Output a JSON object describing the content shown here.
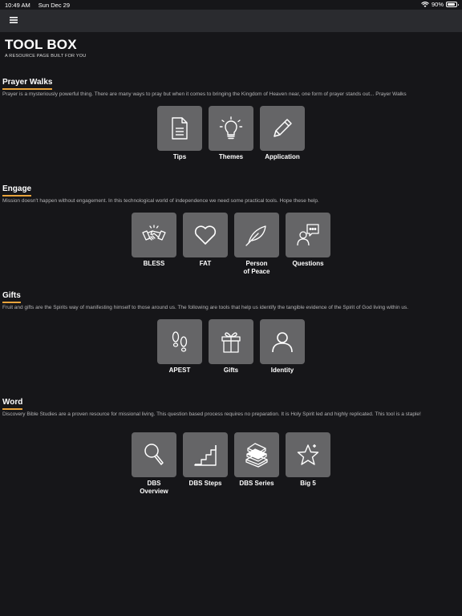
{
  "status": {
    "time": "10:49 AM",
    "date": "Sun Dec 29",
    "battery": "90%"
  },
  "header": {
    "title": "TOOL BOX",
    "subtitle": "A RESOURCE PAGE BUILT FOR YOU"
  },
  "sections": [
    {
      "title": "Prayer Walks",
      "description": "Prayer is a mysteriously powerful thing. There are many ways to pray but when it comes to bringing the Kingdom of Heaven near, one form of prayer stands out... Prayer Walks",
      "tiles": [
        {
          "label": "Tips",
          "icon": "document-icon"
        },
        {
          "label": "Themes",
          "icon": "lightbulb-icon"
        },
        {
          "label": "Application",
          "icon": "pencil-icon"
        }
      ]
    },
    {
      "title": "Engage",
      "description": "Mission doesn't happen without engagement. In this technological world of independence we need some practical tools. Hope these help.",
      "tiles": [
        {
          "label": "BLESS",
          "icon": "handshake-icon"
        },
        {
          "label": "FAT",
          "icon": "heart-icon"
        },
        {
          "label": "Person\nof Peace",
          "icon": "feather-icon"
        },
        {
          "label": "Questions",
          "icon": "person-speech-icon"
        }
      ]
    },
    {
      "title": "Gifts",
      "description": "Fruit and gifts are the Spirits way of manifesting himself to those around us. The following are tools that help us identify the tangible evidence of the Spirit of God living within us.",
      "tiles": [
        {
          "label": "APEST",
          "icon": "footprints-icon"
        },
        {
          "label": "Gifts",
          "icon": "gift-icon"
        },
        {
          "label": "Identity",
          "icon": "person-icon"
        }
      ]
    },
    {
      "title": "Word",
      "description": "Discovery Bible Studies are a proven resource for missional living. This question based process requires no preparation. It is Holy Spirit led and highly replicated. This tool is a staple!",
      "tiles": [
        {
          "label": "DBS\nOverview",
          "icon": "magnifier-icon"
        },
        {
          "label": "DBS Steps",
          "icon": "stairs-icon"
        },
        {
          "label": "DBS Series",
          "icon": "books-icon"
        },
        {
          "label": "Big 5",
          "icon": "star-icon"
        }
      ]
    }
  ]
}
